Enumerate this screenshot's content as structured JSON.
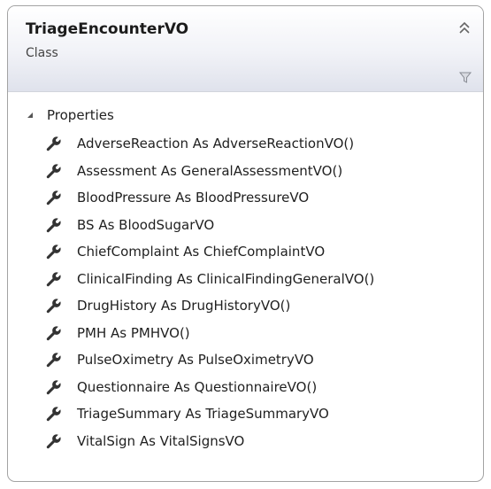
{
  "class_shape": {
    "name": "TriageEncounterVO",
    "kind": "Class",
    "collapse_icon": "double-chevron-up-icon",
    "filter_icon": "funnel-icon"
  },
  "section": {
    "label": "Properties",
    "toggle_icon": "expanded-triangle-icon",
    "member_icon": "wrench-icon"
  },
  "properties": [
    "AdverseReaction As AdverseReactionVO()",
    "Assessment As GeneralAssessmentVO()",
    "BloodPressure As BloodPressureVO",
    "BS As BloodSugarVO",
    "ChiefComplaint As ChiefComplaintVO",
    "ClinicalFinding As ClinicalFindingGeneralVO()",
    "DrugHistory As DrugHistoryVO()",
    "PMH As PMHVO()",
    "PulseOximetry As PulseOximetryVO",
    "Questionnaire As QuestionnaireVO()",
    "TriageSummary As TriageSummaryVO",
    "VitalSign As VitalSignsVO"
  ],
  "colors": {
    "border": "#a3a3a3",
    "header_gradient_bottom": "#dfe2ec",
    "icon": "#333333"
  }
}
